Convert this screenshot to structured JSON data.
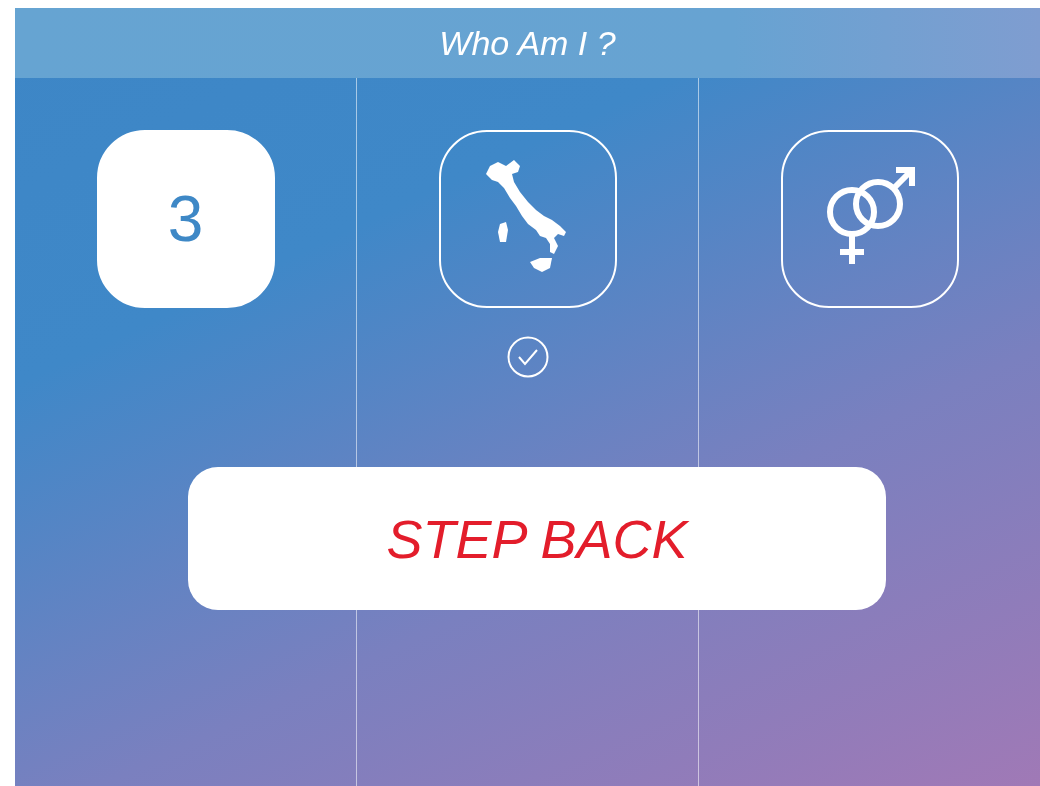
{
  "header": {
    "title": "Who Am I ?"
  },
  "tiles": [
    {
      "kind": "number",
      "text": "3",
      "selected": true,
      "checked": false
    },
    {
      "kind": "country",
      "selected": false,
      "checked": true
    },
    {
      "kind": "gender",
      "selected": false,
      "checked": false
    }
  ],
  "action_button": {
    "label": "STEP BACK"
  }
}
